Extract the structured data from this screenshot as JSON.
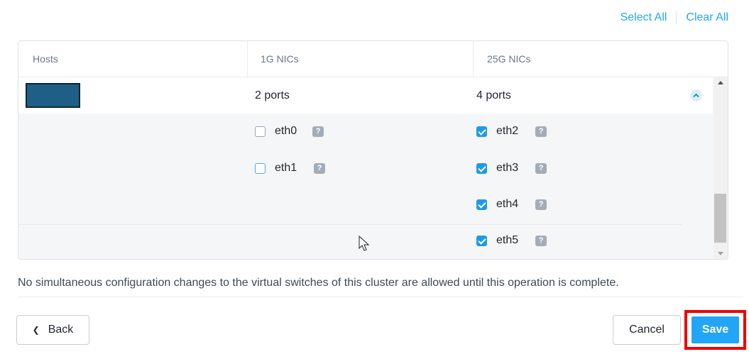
{
  "top_actions": {
    "select_all": "Select All",
    "clear_all": "Clear All"
  },
  "table": {
    "headers": [
      "Hosts",
      "1G NICs",
      "25G NICs"
    ],
    "host_row": {
      "one_g_ports": "2 ports",
      "twentyfive_g_ports": "4 ports"
    },
    "one_g_nics": [
      {
        "name": "eth0",
        "checked": false
      },
      {
        "name": "eth1",
        "checked": false
      }
    ],
    "twentyfive_g_nics": [
      {
        "name": "eth2",
        "checked": true
      },
      {
        "name": "eth3",
        "checked": true
      },
      {
        "name": "eth4",
        "checked": true
      },
      {
        "name": "eth5",
        "checked": true
      }
    ],
    "help_glyph": "?"
  },
  "notice": "No simultaneous configuration changes to the virtual switches of this cluster are allowed until this operation is complete.",
  "footer": {
    "back_label": "Back",
    "cancel_label": "Cancel",
    "save_label": "Save"
  },
  "colors": {
    "accent": "#22a5f7",
    "host_block": "#1e5f86",
    "highlight": "#ee0000"
  },
  "icons": {
    "back": "chevron-left-icon",
    "collapse": "chevron-up-icon",
    "help": "question-icon",
    "pointer": "mouse-pointer-icon"
  }
}
